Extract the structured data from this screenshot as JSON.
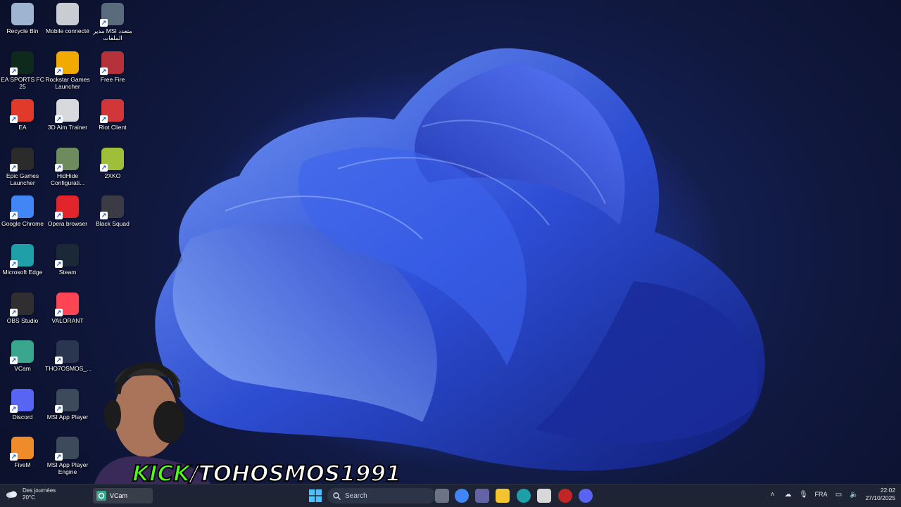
{
  "desktop": {
    "icons": [
      {
        "label": "Recycle Bin",
        "icon": "recycle-bin-icon",
        "color": "#9fb4d1"
      },
      {
        "label": "Mobile connecté",
        "icon": "mobile-icon",
        "color": "#c9ccd2"
      },
      {
        "label": "مدير MSI متعدد الملفات",
        "icon": "msi-multi-icon",
        "color": "#5b6b7e"
      },
      {
        "label": "EA SPORTS FC 25",
        "icon": "ea-fc-icon",
        "color": "#0d2a1c"
      },
      {
        "label": "Rockstar Games Launcher",
        "icon": "rockstar-icon",
        "color": "#f2a900"
      },
      {
        "label": "Free Fire",
        "icon": "free-fire-icon",
        "color": "#b5323a"
      },
      {
        "label": "EA",
        "icon": "ea-icon",
        "color": "#e23a2a"
      },
      {
        "label": "3D Aim Trainer",
        "icon": "aim-trainer-icon",
        "color": "#d7d9dc"
      },
      {
        "label": "Riot Client",
        "icon": "riot-icon",
        "color": "#d13639"
      },
      {
        "label": "Epic Games Launcher",
        "icon": "epic-games-icon",
        "color": "#2b2b2b"
      },
      {
        "label": "HidHide Configurati...",
        "icon": "hidhide-icon",
        "color": "#6d8b5c"
      },
      {
        "label": "2XKO",
        "icon": "2xko-icon",
        "color": "#9fbf3a"
      },
      {
        "label": "Google Chrome",
        "icon": "chrome-icon",
        "color": "#4285f4"
      },
      {
        "label": "Opera browser",
        "icon": "opera-icon",
        "color": "#e2242b"
      },
      {
        "label": "Black Squad",
        "icon": "black-squad-icon",
        "color": "#3b3b46"
      },
      {
        "label": "Microsoft Edge",
        "icon": "edge-icon",
        "color": "#1fa0a8"
      },
      {
        "label": "Steam",
        "icon": "steam-icon",
        "color": "#1b2838"
      },
      {
        "label": "",
        "icon": "",
        "color": ""
      },
      {
        "label": "OBS Studio",
        "icon": "obs-icon",
        "color": "#302e31"
      },
      {
        "label": "VALORANT",
        "icon": "valorant-icon",
        "color": "#fd4556"
      },
      {
        "label": "",
        "icon": "",
        "color": ""
      },
      {
        "label": "VCam",
        "icon": "vcam-icon",
        "color": "#3aa68e"
      },
      {
        "label": "THO7OSMOS_...",
        "icon": "file-icon",
        "color": "#2a3550"
      },
      {
        "label": "",
        "icon": "",
        "color": ""
      },
      {
        "label": "Discord",
        "icon": "discord-icon",
        "color": "#5865f2"
      },
      {
        "label": "MSI App Player",
        "icon": "msi-app-player-icon",
        "color": "#3c4a5c"
      },
      {
        "label": "",
        "icon": "",
        "color": ""
      },
      {
        "label": "FiveM",
        "icon": "fivem-icon",
        "color": "#f08b2b"
      },
      {
        "label": "MSI App Player Engine",
        "icon": "msi-engine-icon",
        "color": "#3c4a5c"
      }
    ]
  },
  "overlay": {
    "kick_prefix": "KICK",
    "kick_handle": "/TOHOSMOS1991"
  },
  "taskbar": {
    "weather_line1": "Des journées",
    "weather_line2": "20°C",
    "vcam_label": "VCam",
    "search_placeholder": "Search",
    "language": "FRA",
    "time": "22:02",
    "date": "27/10/2025",
    "apps": [
      {
        "name": "taskview-icon",
        "color": "#6b7385"
      },
      {
        "name": "chrome-taskbar-icon",
        "color": "#4285f4"
      },
      {
        "name": "teams-icon",
        "color": "#6264a7"
      },
      {
        "name": "file-explorer-icon",
        "color": "#f4c430"
      },
      {
        "name": "edge-taskbar-icon",
        "color": "#1fa0a8"
      },
      {
        "name": "store-icon",
        "color": "#d8d8d8"
      },
      {
        "name": "game-app-icon",
        "color": "#c02626"
      },
      {
        "name": "discord-taskbar-icon",
        "color": "#5865f2"
      }
    ]
  },
  "colors": {
    "kick_green": "#53fc18",
    "taskbar_bg": "#1e2433"
  }
}
